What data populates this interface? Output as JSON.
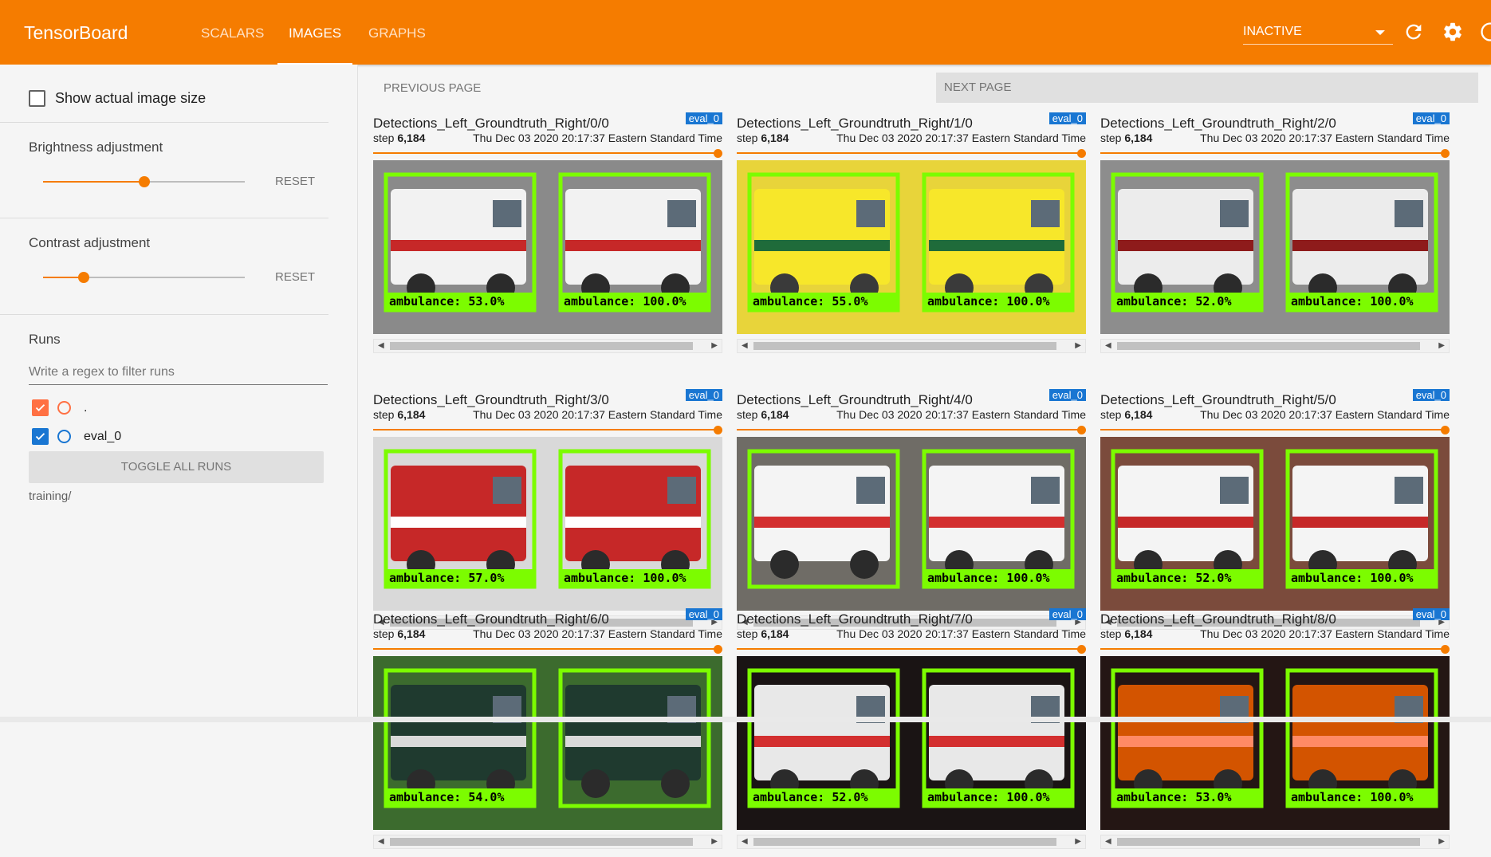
{
  "header": {
    "brand": "TensorBoard",
    "tabs": [
      {
        "label": "SCALARS",
        "active": false
      },
      {
        "label": "IMAGES",
        "active": true
      },
      {
        "label": "GRAPHS",
        "active": false
      }
    ],
    "status": "INACTIVE",
    "accent_color": "#f57c00"
  },
  "sidebar": {
    "show_actual_size_label": "Show actual image size",
    "brightness_label": "Brightness adjustment",
    "brightness_value": 0.5,
    "contrast_label": "Contrast adjustment",
    "contrast_value": 0.2,
    "reset_label": "RESET",
    "runs_label": "Runs",
    "regex_placeholder": "Write a regex to filter runs",
    "runs": [
      {
        "name": ".",
        "checked": true,
        "color": "#ff7043"
      },
      {
        "name": "eval_0",
        "checked": true,
        "color": "#1976d2"
      }
    ],
    "toggle_all_label": "TOGGLE ALL RUNS",
    "group_label": "training/"
  },
  "main": {
    "prev_label": "PREVIOUS PAGE",
    "next_label": "NEXT PAGE",
    "cards": [
      {
        "title": "Detections_Left_Groundtruth_Right/0/0",
        "tag": "eval_0",
        "step_label": "step",
        "step": "6,184",
        "time": "Thu Dec 03 2020 20:17:37 Eastern Standard Time",
        "scene": "white-ambulance",
        "left_label": "ambulance: 53.0%",
        "right_label": "ambulance: 100.0%"
      },
      {
        "title": "Detections_Left_Groundtruth_Right/1/0",
        "tag": "eval_0",
        "step_label": "step",
        "step": "6,184",
        "time": "Thu Dec 03 2020 20:17:37 Eastern Standard Time",
        "scene": "yellow-ambulance",
        "left_label": "ambulance: 55.0%",
        "right_label": "ambulance: 100.0%"
      },
      {
        "title": "Detections_Left_Groundtruth_Right/2/0",
        "tag": "eval_0",
        "step_label": "step",
        "step": "6,184",
        "time": "Thu Dec 03 2020 20:17:37 Eastern Standard Time",
        "scene": "white-red-ambulance",
        "left_label": "ambulance: 52.0%",
        "right_label": "ambulance: 100.0%"
      },
      {
        "title": "Detections_Left_Groundtruth_Right/3/0",
        "tag": "eval_0",
        "step_label": "step",
        "step": "6,184",
        "time": "Thu Dec 03 2020 20:17:37 Eastern Standard Time",
        "scene": "red-ambulance",
        "left_label": "ambulance: 57.0%",
        "right_label": "ambulance: 100.0%"
      },
      {
        "title": "Detections_Left_Groundtruth_Right/4/0",
        "tag": "eval_0",
        "step_label": "step",
        "step": "6,184",
        "time": "Thu Dec 03 2020 20:17:37 Eastern Standard Time",
        "scene": "amr-ambulance",
        "left_label": "",
        "right_label": "ambulance: 100.0%"
      },
      {
        "title": "Detections_Left_Groundtruth_Right/5/0",
        "tag": "eval_0",
        "step_label": "step",
        "step": "6,184",
        "time": "Thu Dec 03 2020 20:17:37 Eastern Standard Time",
        "scene": "van-ambulance",
        "left_label": "ambulance: 52.0%",
        "right_label": "ambulance: 100.0%"
      },
      {
        "title": "Detections_Left_Groundtruth_Right/6/0",
        "tag": "eval_0",
        "step_label": "step",
        "step": "6,184",
        "time": "Thu Dec 03 2020 20:17:37 Eastern Standard Time",
        "scene": "green-ambulance",
        "left_label": "ambulance: 54.0%",
        "right_label": ""
      },
      {
        "title": "Detections_Left_Groundtruth_Right/7/0",
        "tag": "eval_0",
        "step_label": "step",
        "step": "6,184",
        "time": "Thu Dec 03 2020 20:17:37 Eastern Standard Time",
        "scene": "night-ambulance",
        "left_label": "ambulance: 52.0%",
        "right_label": "ambulance: 100.0%"
      },
      {
        "title": "Detections_Left_Groundtruth_Right/8/0",
        "tag": "eval_0",
        "step_label": "step",
        "step": "6,184",
        "time": "Thu Dec 03 2020 20:17:37 Eastern Standard Time",
        "scene": "night-ambulance-2",
        "left_label": "ambulance: 53.0%",
        "right_label": "ambulance: 100.0%"
      }
    ]
  }
}
